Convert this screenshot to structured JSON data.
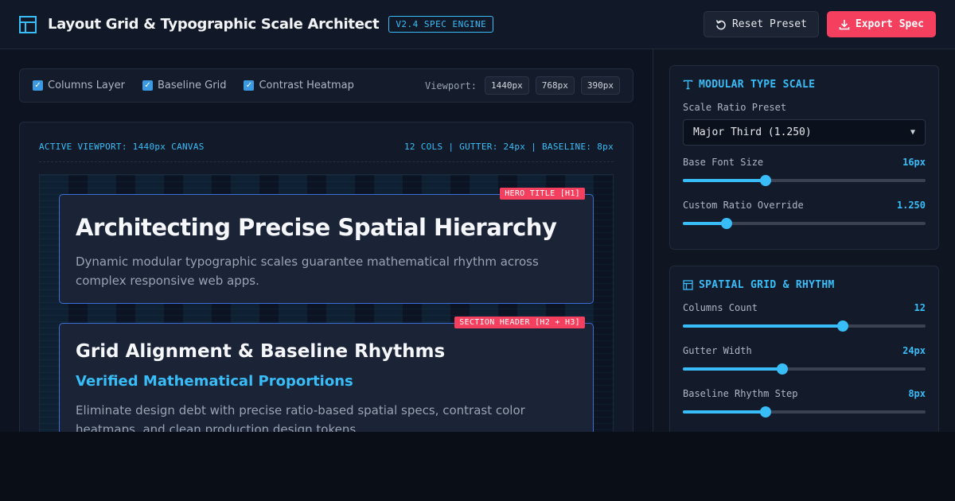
{
  "header": {
    "title": "Layout Grid & Typographic Scale Architect",
    "version_badge": "V2.4 SPEC ENGINE",
    "reset_label": "Reset Preset",
    "export_label": "Export Spec",
    "icons": {
      "brand": "layout-grid-icon",
      "reset": "rotate-ccw-icon",
      "export": "download-icon"
    },
    "accent_color": "#38bdf8",
    "export_color": "#f43f5e"
  },
  "layers": {
    "items": [
      {
        "label": "Columns Layer",
        "checked": true
      },
      {
        "label": "Baseline Grid",
        "checked": true
      },
      {
        "label": "Contrast Heatmap",
        "checked": true
      }
    ],
    "viewport_label": "Viewport:",
    "viewports": [
      "1440px",
      "768px",
      "390px"
    ]
  },
  "canvas": {
    "active_label": "ACTIVE VIEWPORT: 1440px CANVAS",
    "grid_summary": "12 COLS | GUTTER: 24px | BASELINE: 8px",
    "hero": {
      "tag": "HERO TITLE [H1]",
      "title": "Architecting Precise Spatial Hierarchy",
      "subtitle": "Dynamic modular typographic scales guarantee mathematical rhythm across complex responsive web apps."
    },
    "section": {
      "tag": "SECTION HEADER [H2 + H3]",
      "h2": "Grid Alignment & Baseline Rhythms",
      "h3": "Verified Mathematical Proportions",
      "body": "Eliminate design debt with precise ratio-based spatial specs, contrast color heatmaps, and clean production design tokens."
    }
  },
  "type_scale": {
    "title": "MODULAR TYPE SCALE",
    "icon": "type-icon",
    "preset_label": "Scale Ratio Preset",
    "preset_value": "Major Third (1.250)",
    "base_font": {
      "label": "Base Font Size",
      "display": "16px",
      "fraction": 0.34
    },
    "ratio_override": {
      "label": "Custom Ratio Override",
      "display": "1.250",
      "fraction": 0.18
    }
  },
  "spatial": {
    "title": "SPATIAL GRID & RHYTHM",
    "icon": "layout-icon",
    "columns": {
      "label": "Columns Count",
      "display": "12",
      "fraction": 0.66
    },
    "gutter": {
      "label": "Gutter Width",
      "display": "24px",
      "fraction": 0.41
    },
    "baseline": {
      "label": "Baseline Rhythm Step",
      "display": "8px",
      "fraction": 0.34
    }
  }
}
